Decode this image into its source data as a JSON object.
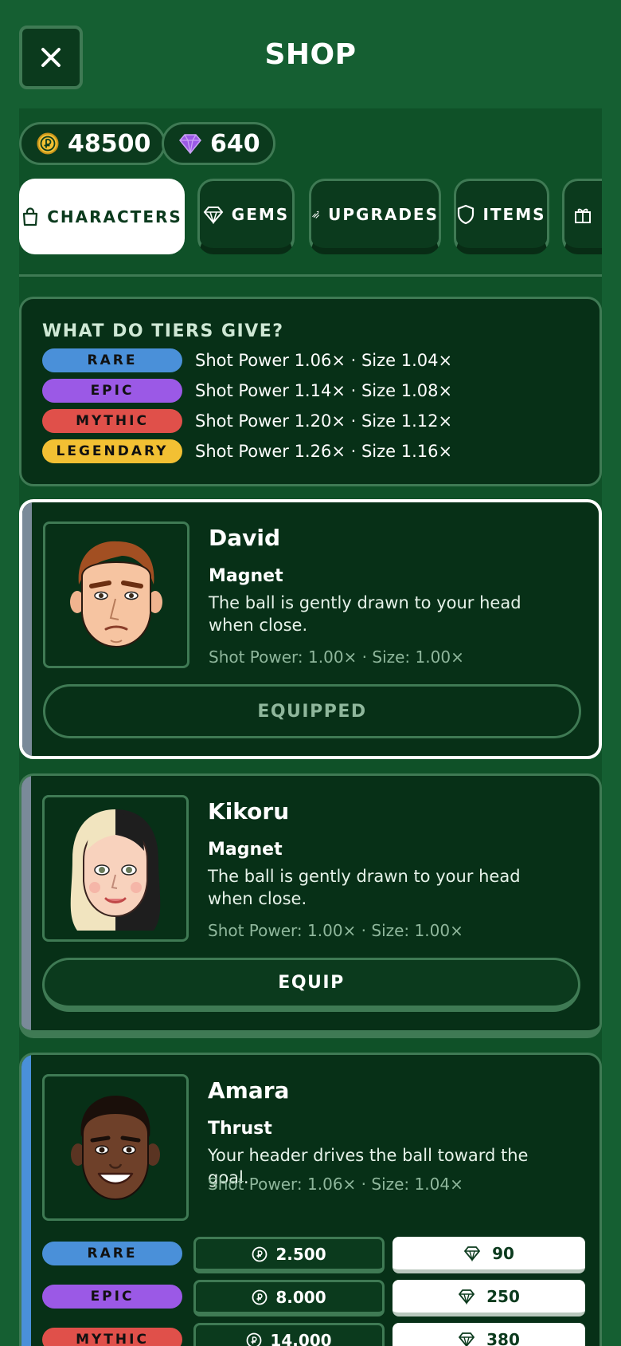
{
  "header": {
    "title": "SHOP",
    "close_icon": "close-icon"
  },
  "currency": {
    "coins": "48500",
    "gems": "640",
    "coin_icon": "coin-icon",
    "gem_icon": "gem-icon"
  },
  "tabs": [
    {
      "label": "CHARACTERS",
      "icon": "bag-icon",
      "active": true
    },
    {
      "label": "GEMS",
      "icon": "gem-icon"
    },
    {
      "label": "UPGRADES",
      "icon": "upgrade-icon"
    },
    {
      "label": "ITEMS",
      "icon": "shield-icon"
    },
    {
      "label": "",
      "icon": "gift-icon"
    }
  ],
  "tiers_info": {
    "title": "WHAT DO TIERS GIVE?",
    "rows": [
      {
        "tier": "RARE",
        "desc": "Shot Power 1.06× · Size 1.04×",
        "color": "#4a90d9"
      },
      {
        "tier": "EPIC",
        "desc": "Shot Power 1.14× · Size 1.08×",
        "color": "#9b59e6"
      },
      {
        "tier": "MYTHIC",
        "desc": "Shot Power 1.20× · Size 1.12×",
        "color": "#e0504a"
      },
      {
        "tier": "LEGENDARY",
        "desc": "Shot Power 1.26× · Size 1.16×",
        "color": "#f2c033"
      }
    ]
  },
  "characters": [
    {
      "name": "David",
      "ability": "Magnet",
      "ability_desc": "The ball is gently drawn to your head when close.",
      "stats": "Shot Power: 1.00× · Size: 1.00×",
      "button": "EQUIPPED",
      "selected": true,
      "stripe_color": "#7a8a99"
    },
    {
      "name": "Kikoru",
      "ability": "Magnet",
      "ability_desc": "The ball is gently drawn to your head when close.",
      "stats": "Shot Power: 1.00× · Size: 1.00×",
      "button": "EQUIP",
      "stripe_color": "#7a8a99"
    },
    {
      "name": "Amara",
      "ability": "Thrust",
      "ability_desc": "Your header drives the ball toward the goal.",
      "stats": "Shot Power: 1.06× · Size: 1.04×",
      "stripe_color": "#4a90d9",
      "prices": [
        {
          "tier": "RARE",
          "coins": "2.500",
          "gems": "90"
        },
        {
          "tier": "EPIC",
          "coins": "8.000",
          "gems": "250"
        },
        {
          "tier": "MYTHIC",
          "coins": "14.000",
          "gems": "380"
        }
      ]
    }
  ]
}
